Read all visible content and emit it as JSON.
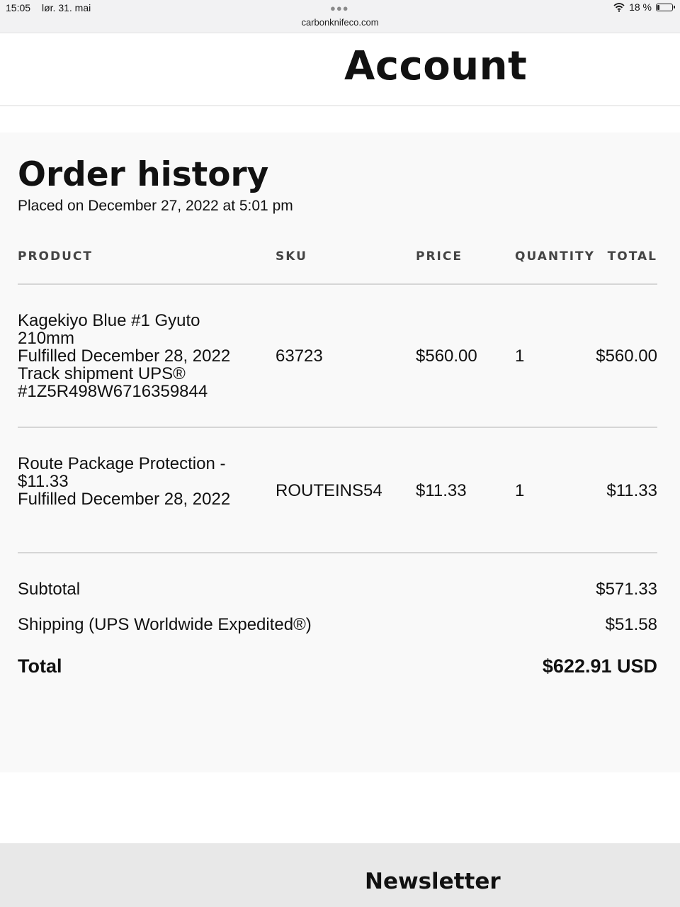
{
  "status_bar": {
    "time": "15:05",
    "date": "lør. 31. mai",
    "url": "carbonknifeco.com",
    "battery_text": "18 %",
    "battery_level": 0.18,
    "icons": [
      "wifi-icon",
      "battery-icon"
    ]
  },
  "header": {
    "title": "Account"
  },
  "order": {
    "title": "Order history",
    "placed_on": "Placed on December 27, 2022 at 5:01 pm",
    "columns": {
      "product": "PRODUCT",
      "sku": "SKU",
      "price": "PRICE",
      "quantity": "QUANTITY",
      "total": "TOTAL"
    },
    "items": [
      {
        "name": "Kagekiyo Blue #1 Gyuto 210mm",
        "fulfillment": "Fulfilled December 28, 2022 Track shipment UPS® #1Z5R498W6716359844",
        "sku": "63723",
        "price": "$560.00",
        "quantity": "1",
        "total": "$560.00"
      },
      {
        "name": "Route Package Protection - $11.33",
        "fulfillment": "Fulfilled December 28, 2022",
        "sku": "ROUTEINS54",
        "price": "$11.33",
        "quantity": "1",
        "total": "$11.33"
      }
    ],
    "summary": {
      "subtotal_label": "Subtotal",
      "subtotal": "$571.33",
      "shipping_label": "Shipping (UPS Worldwide Expedited®)",
      "shipping": "$51.58",
      "total_label": "Total",
      "total": "$622.91 USD"
    }
  },
  "footer": {
    "title": "Newsletter"
  },
  "colors": {
    "panel_bg": "#f9f9f9",
    "footer_bg": "#e8e8e8",
    "text": "#111111"
  }
}
